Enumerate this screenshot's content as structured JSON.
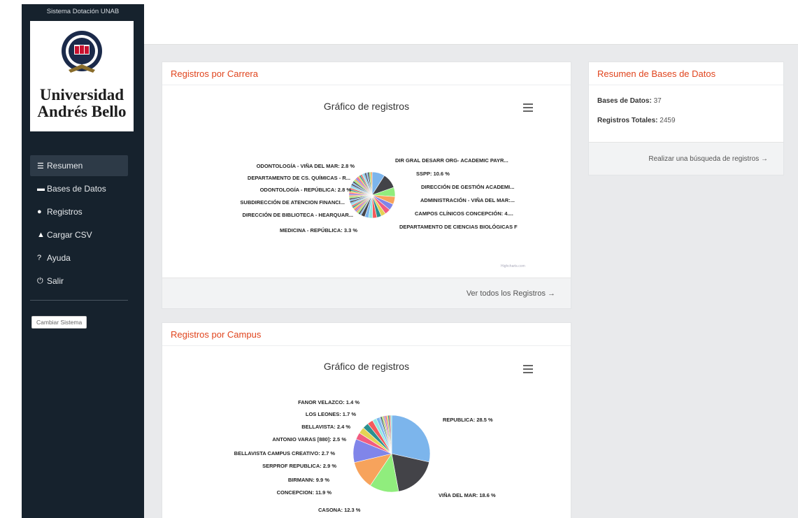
{
  "sidebar": {
    "system_title": "Sistema Dotación UNAB",
    "logo_line1": "Universidad",
    "logo_line2": "Andrés Bello",
    "items": [
      {
        "label": "Resumen",
        "icon": "list-icon"
      },
      {
        "label": "Bases de Datos",
        "icon": "database-icon"
      },
      {
        "label": "Registros",
        "icon": "user-icon"
      },
      {
        "label": "Cargar CSV",
        "icon": "upload-user-icon"
      },
      {
        "label": "Ayuda",
        "icon": "help-icon"
      },
      {
        "label": "Salir",
        "icon": "power-icon"
      }
    ],
    "change_button": "Cambiar Sistema"
  },
  "panel_carrera": {
    "title": "Registros por Carrera",
    "chart_title": "Gráfico de registros",
    "footer_link": "Ver todos los Registros →",
    "credit": "Highcharts.com"
  },
  "panel_campus": {
    "title": "Registros por Campus",
    "chart_title": "Gráfico de registros"
  },
  "panel_resumen": {
    "title": "Resumen de Bases de Datos",
    "bases_label": "Bases de Datos:",
    "bases_value": "37",
    "registros_label": "Registros Totales:",
    "registros_value": "2459",
    "footer_link": "Realizar una búsqueda de registros →"
  },
  "chart_data": [
    {
      "type": "pie",
      "title": "Gráfico de registros",
      "labels": [
        "DIR GRAL DESARR ORG- ACADEMIC PAYR...",
        "SSPP: 10.6 %",
        "DIRECCIÓN DE GESTIÓN ACADEMI...",
        "ADMINISTRACIÓN - VIÑA DEL MAR:...",
        "CAMPOS CLÍNICOS CONCEPCIÓN: 4....",
        "DEPARTAMENTO DE CIENCIAS BIOLÓGICAS F",
        "MEDICINA - REPÚBLICA: 3.3 %",
        "DIRECCIÓN DE BIBLIOTECA - HEARQUAR...",
        "SUBDIRECCIÓN DE ATENCION FINANCI...",
        "ODONTOLOGÍA - REPÚBLICA: 2.8 %",
        "DEPARTAMENTO DE CS. QUÍMICAS - R...",
        "ODONTOLOGÍA - VIÑA DEL MAR: 2.8 %"
      ],
      "values": [
        9.0,
        10.6,
        6.5,
        5.5,
        4.5,
        4.0,
        3.3,
        3.2,
        3.0,
        2.8,
        2.8,
        2.8,
        42.0
      ],
      "colors": [
        "#7cb5ec",
        "#434348",
        "#90ed7d",
        "#f7a35c",
        "#8085e9",
        "#f15c80",
        "#e4d354",
        "#2b908f",
        "#f45b5b",
        "#91e8e1",
        "#7cb5ec",
        "#434348",
        "#b8c8d8"
      ]
    },
    {
      "type": "pie",
      "title": "Gráfico de registros",
      "labels": [
        "REPUBLICA: 28.5 %",
        "VIÑA DEL MAR: 18.6 %",
        "CASONA: 12.3 %",
        "CONCEPCION: 11.9 %",
        "BIRMANN: 9.9 %",
        "SERPROF REPUBLICA: 2.9 %",
        "BELLAVISTA CAMPUS CREATIVO: 2.7 %",
        "ANTONIO VARAS [880]: 2.5 %",
        "BELLAVISTA: 2.4 %",
        "LOS LEONES: 1.7 %",
        "FANOR VELAZCO: 1.4 %"
      ],
      "values": [
        28.5,
        18.6,
        12.3,
        11.9,
        9.9,
        2.9,
        2.7,
        2.5,
        2.4,
        1.7,
        1.4,
        5.2
      ],
      "colors": [
        "#7cb5ec",
        "#434348",
        "#90ed7d",
        "#f7a35c",
        "#8085e9",
        "#f15c80",
        "#e4d354",
        "#2b908f",
        "#f45b5b",
        "#91e8e1",
        "#7cb5ec",
        "#d8c8b8"
      ]
    }
  ]
}
